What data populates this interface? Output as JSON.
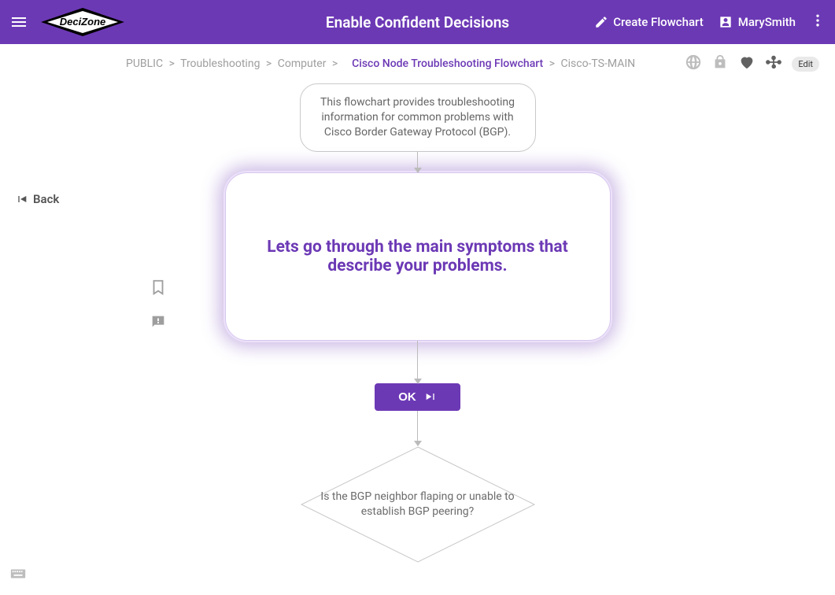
{
  "header": {
    "title": "Enable Confident Decisions",
    "logo_text": "DeciZone",
    "create_label": "Create Flowchart",
    "user_name": "MarySmith"
  },
  "breadcrumb": {
    "items": [
      "PUBLIC",
      "Troubleshooting",
      "Computer"
    ],
    "current": "Cisco Node Troubleshooting Flowchart",
    "suffix": "Cisco-TS-MAIN",
    "sep": ">"
  },
  "toolbar": {
    "edit_label": "Edit"
  },
  "nav": {
    "back_label": "Back"
  },
  "flow": {
    "intro": "This flowchart provides troubleshooting information for common problems with Cisco Border Gateway Protocol (BGP).",
    "main": "Lets go through the main symptoms that describe your problems.",
    "ok_label": "OK",
    "diamond": "Is the BGP neighbor flaping or unable to establish BGP peering?"
  }
}
